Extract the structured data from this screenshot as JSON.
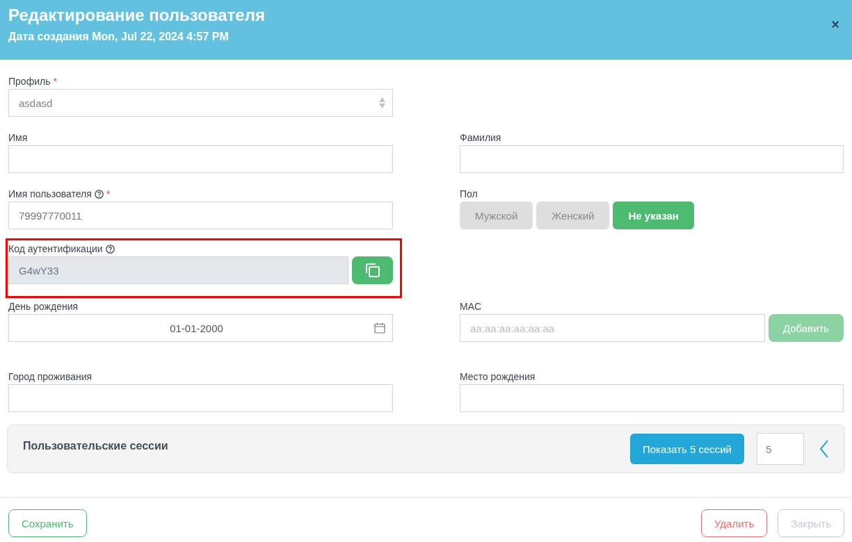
{
  "header": {
    "title": "Редактирование пользователя",
    "subtitle": "Дата создания Mon, Jul 22, 2024 4:57 PM",
    "close": "×"
  },
  "profile": {
    "label": "Профиль",
    "required_mark": "*",
    "value": "asdasd"
  },
  "first_name": {
    "label": "Имя"
  },
  "last_name": {
    "label": "Фамилия"
  },
  "username": {
    "label": "Имя пользователя",
    "help": true,
    "required_mark": "*",
    "value": "79997770011"
  },
  "gender": {
    "label": "Пол",
    "options": [
      {
        "label": "Мужской",
        "selected": false
      },
      {
        "label": "Женский",
        "selected": false
      },
      {
        "label": "Не указан",
        "selected": true
      }
    ]
  },
  "auth_code": {
    "label": "Код аутентификации",
    "help": true,
    "value": "G4wY33",
    "disabled": true,
    "highlighted": true
  },
  "birthday": {
    "label": "День рождения",
    "value": "01-01-2000"
  },
  "mac": {
    "label": "MAC",
    "placeholder": "aa:aa:aa:aa:aa:aa",
    "button": {
      "label": "Добавить",
      "disabled": true
    }
  },
  "city": {
    "label": "Город проживания"
  },
  "birthplace": {
    "label": "Место рождения"
  },
  "sessions": {
    "title": "Пользовательские сессии",
    "button": "Показать 5 сессий",
    "count": "5"
  },
  "footer": {
    "buttons": [
      {
        "kind": "save",
        "label": "Сохранить",
        "disabled": false
      },
      {
        "kind": "delete",
        "label": "Удалить",
        "disabled": false
      },
      {
        "kind": "close",
        "label": "Закрыть",
        "disabled": true
      }
    ]
  }
}
